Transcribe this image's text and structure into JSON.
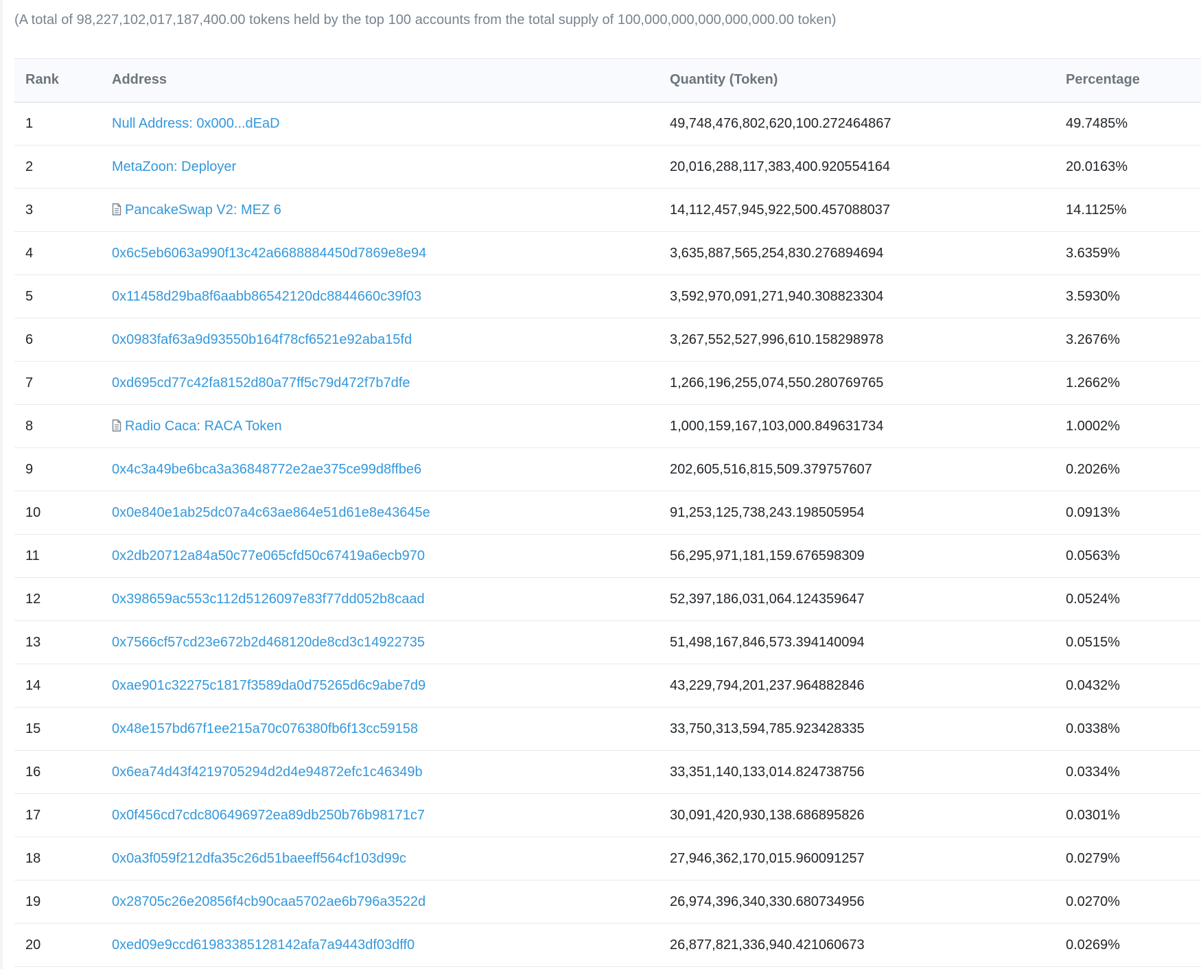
{
  "summary": {
    "text": "(A total of 98,227,102,017,187,400.00 tokens held by the top 100 accounts from the total supply of 100,000,000,000,000,000.00 token)"
  },
  "table": {
    "headers": {
      "rank": "Rank",
      "address": "Address",
      "quantity": "Quantity (Token)",
      "percentage": "Percentage"
    },
    "rows": [
      {
        "rank": "1",
        "address": "Null Address: 0x000...dEaD",
        "contract": false,
        "quantity": "49,748,476,802,620,100.272464867",
        "percentage": "49.7485%"
      },
      {
        "rank": "2",
        "address": "MetaZoon: Deployer",
        "contract": false,
        "quantity": "20,016,288,117,383,400.920554164",
        "percentage": "20.0163%"
      },
      {
        "rank": "3",
        "address": "PancakeSwap V2: MEZ 6",
        "contract": true,
        "quantity": "14,112,457,945,922,500.457088037",
        "percentage": "14.1125%"
      },
      {
        "rank": "4",
        "address": "0x6c5eb6063a990f13c42a6688884450d7869e8e94",
        "contract": false,
        "quantity": "3,635,887,565,254,830.276894694",
        "percentage": "3.6359%"
      },
      {
        "rank": "5",
        "address": "0x11458d29ba8f6aabb86542120dc8844660c39f03",
        "contract": false,
        "quantity": "3,592,970,091,271,940.308823304",
        "percentage": "3.5930%"
      },
      {
        "rank": "6",
        "address": "0x0983faf63a9d93550b164f78cf6521e92aba15fd",
        "contract": false,
        "quantity": "3,267,552,527,996,610.158298978",
        "percentage": "3.2676%"
      },
      {
        "rank": "7",
        "address": "0xd695cd77c42fa8152d80a77ff5c79d472f7b7dfe",
        "contract": false,
        "quantity": "1,266,196,255,074,550.280769765",
        "percentage": "1.2662%"
      },
      {
        "rank": "8",
        "address": "Radio Caca: RACA Token",
        "contract": true,
        "quantity": "1,000,159,167,103,000.849631734",
        "percentage": "1.0002%"
      },
      {
        "rank": "9",
        "address": "0x4c3a49be6bca3a36848772e2ae375ce99d8ffbe6",
        "contract": false,
        "quantity": "202,605,516,815,509.379757607",
        "percentage": "0.2026%"
      },
      {
        "rank": "10",
        "address": "0x0e840e1ab25dc07a4c63ae864e51d61e8e43645e",
        "contract": false,
        "quantity": "91,253,125,738,243.198505954",
        "percentage": "0.0913%"
      },
      {
        "rank": "11",
        "address": "0x2db20712a84a50c77e065cfd50c67419a6ecb970",
        "contract": false,
        "quantity": "56,295,971,181,159.676598309",
        "percentage": "0.0563%"
      },
      {
        "rank": "12",
        "address": "0x398659ac553c112d5126097e83f77dd052b8caad",
        "contract": false,
        "quantity": "52,397,186,031,064.124359647",
        "percentage": "0.0524%"
      },
      {
        "rank": "13",
        "address": "0x7566cf57cd23e672b2d468120de8cd3c14922735",
        "contract": false,
        "quantity": "51,498,167,846,573.394140094",
        "percentage": "0.0515%"
      },
      {
        "rank": "14",
        "address": "0xae901c32275c1817f3589da0d75265d6c9abe7d9",
        "contract": false,
        "quantity": "43,229,794,201,237.964882846",
        "percentage": "0.0432%"
      },
      {
        "rank": "15",
        "address": "0x48e157bd67f1ee215a70c076380fb6f13cc59158",
        "contract": false,
        "quantity": "33,750,313,594,785.923428335",
        "percentage": "0.0338%"
      },
      {
        "rank": "16",
        "address": "0x6ea74d43f4219705294d2d4e94872efc1c46349b",
        "contract": false,
        "quantity": "33,351,140,133,014.824738756",
        "percentage": "0.0334%"
      },
      {
        "rank": "17",
        "address": "0x0f456cd7cdc806496972ea89db250b76b98171c7",
        "contract": false,
        "quantity": "30,091,420,930,138.686895826",
        "percentage": "0.0301%"
      },
      {
        "rank": "18",
        "address": "0x0a3f059f212dfa35c26d51baeeff564cf103d99c",
        "contract": false,
        "quantity": "27,946,362,170,015.960091257",
        "percentage": "0.0279%"
      },
      {
        "rank": "19",
        "address": "0x28705c26e20856f4cb90caa5702ae6b796a3522d",
        "contract": false,
        "quantity": "26,974,396,340,330.680734956",
        "percentage": "0.0270%"
      },
      {
        "rank": "20",
        "address": "0xed09e9ccd61983385128142afa7a9443df03dff0",
        "contract": false,
        "quantity": "26,877,821,336,940.421060673",
        "percentage": "0.0269%"
      }
    ]
  },
  "icons": {
    "contract": "file-document-icon"
  },
  "colors": {
    "link": "#3498db",
    "muted": "#77838f",
    "header_text": "#6c757d",
    "border": "#e7eaf3",
    "header_bg": "#f8fafd"
  }
}
